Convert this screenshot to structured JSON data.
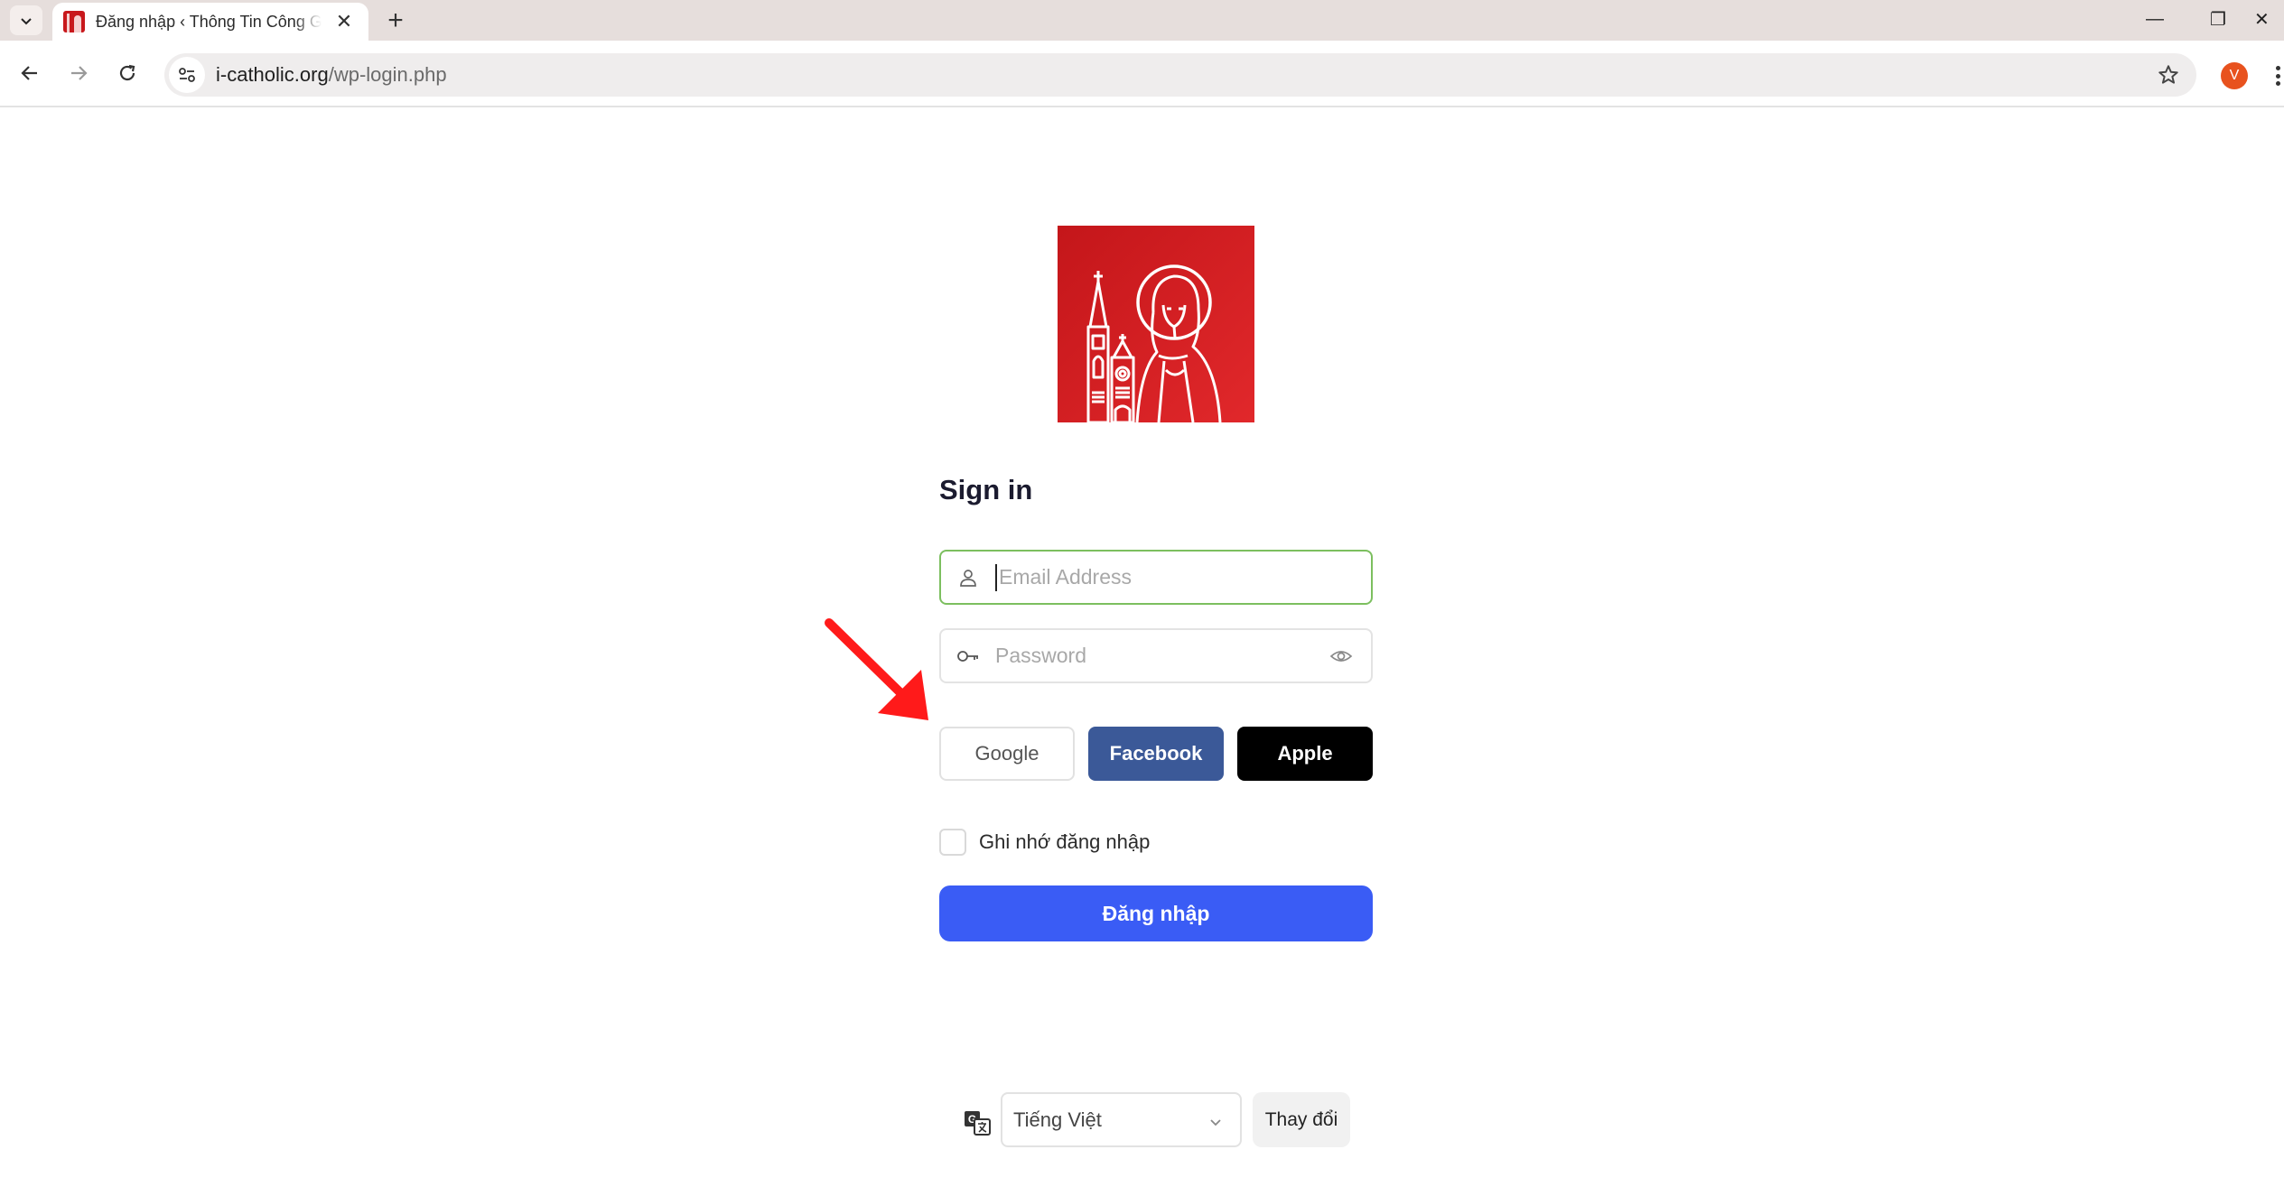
{
  "browser": {
    "tab_title": "Đăng nhập ‹ Thông Tin Công Giáo",
    "tab_close_glyph": "✕",
    "new_tab_glyph": "+",
    "url_host": "i-catholic.org",
    "url_path": "/wp-login.php",
    "profile_initial": "V",
    "window_controls": {
      "minimize": "—",
      "restore": "❐",
      "close": "✕"
    }
  },
  "login": {
    "heading": "Sign in",
    "email_placeholder": "Email Address",
    "password_placeholder": "Password",
    "social": {
      "google": "Google",
      "facebook": "Facebook",
      "apple": "Apple"
    },
    "remember_label": "Ghi nhớ đăng nhập",
    "submit_label": "Đăng nhập"
  },
  "language": {
    "selected": "Tiếng Việt",
    "change_label": "Thay đổi"
  },
  "colors": {
    "logo_red": "#c4161a",
    "facebook_blue": "#3b5998",
    "apple_black": "#000000",
    "submit_blue": "#3a5cf5",
    "focus_green": "#7cbf5f",
    "annotation_red": "#ff1a1a"
  }
}
